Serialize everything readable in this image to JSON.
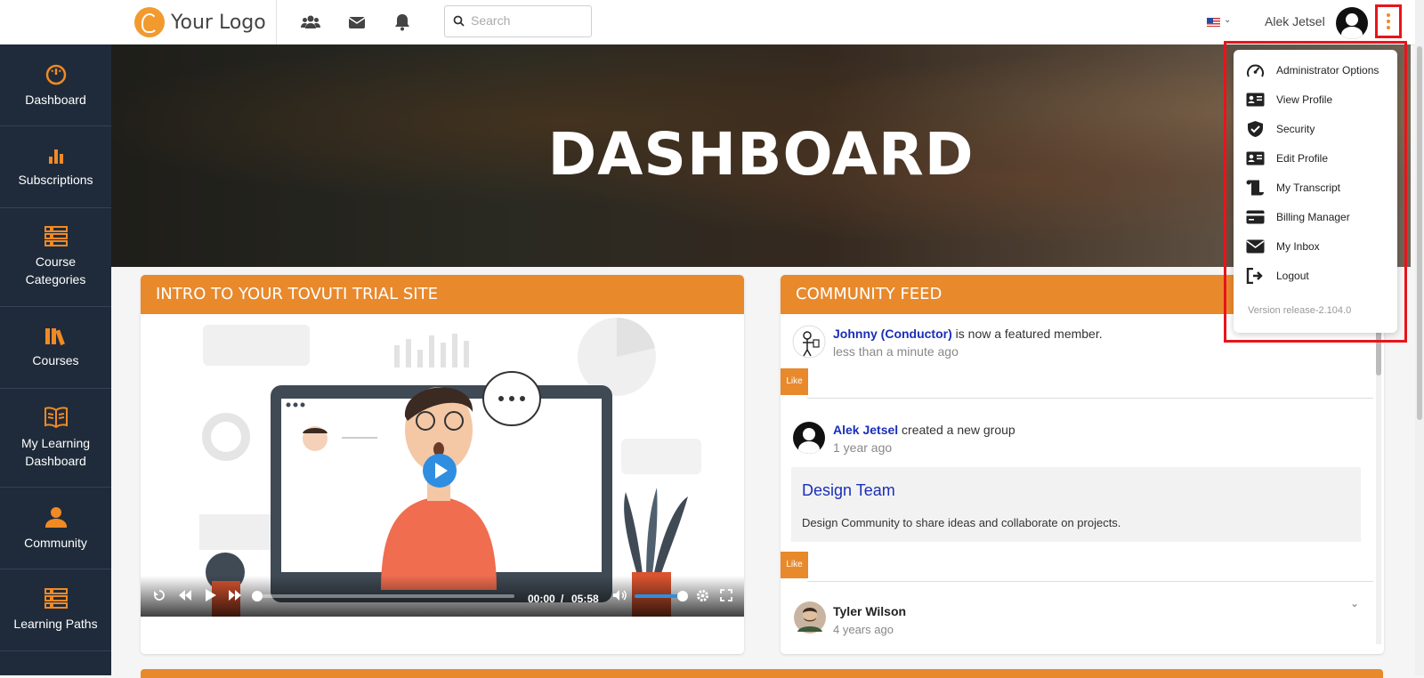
{
  "app": {
    "logo_text": "Your Logo",
    "username": "Alek Jetsel",
    "language_flag": "us-flag-icon"
  },
  "search": {
    "placeholder": "Search",
    "value": ""
  },
  "top_icons": [
    "users-icon",
    "envelope-icon",
    "bell-icon"
  ],
  "sidebar": {
    "items": [
      {
        "label": "Dashboard",
        "icon": "gauge-icon"
      },
      {
        "label": "Subscriptions",
        "icon": "bar-chart-icon"
      },
      {
        "label": "Course Categories",
        "icon": "list-icon"
      },
      {
        "label": "Courses",
        "icon": "books-icon"
      },
      {
        "label": "My Learning Dashboard",
        "icon": "open-book-icon"
      },
      {
        "label": "Community",
        "icon": "community-icon"
      },
      {
        "label": "Learning Paths",
        "icon": "list-icon"
      }
    ]
  },
  "banner": {
    "title": "DASHBOARD"
  },
  "intro_card": {
    "title": "INTRO TO YOUR TOVUTI TRIAL SITE",
    "video": {
      "current_time": "00:00",
      "separator": "/",
      "duration": "05:58",
      "progress": 0.0,
      "volume": 1.0
    }
  },
  "feed": {
    "title": "COMMUNITY FEED",
    "like_label": "Like",
    "items": [
      {
        "name": "Johnny (Conductor)",
        "action": " is now a featured member.",
        "time": "less than a minute ago"
      },
      {
        "name": "Alek Jetsel",
        "action": " created a new group",
        "time": "1 year ago",
        "group": {
          "title": "Design Team",
          "description": "Design Community to share ideas and collaborate on projects."
        }
      },
      {
        "name": "Tyler Wilson",
        "action": "",
        "time": "4 years ago"
      }
    ]
  },
  "dropdown": {
    "items": [
      {
        "label": "Administrator Options",
        "icon": "speedometer-icon"
      },
      {
        "label": "View Profile",
        "icon": "id-card-icon"
      },
      {
        "label": "Security",
        "icon": "shield-check-icon"
      },
      {
        "label": "Edit Profile",
        "icon": "id-card-icon"
      },
      {
        "label": "My Transcript",
        "icon": "scroll-icon"
      },
      {
        "label": "Billing Manager",
        "icon": "credit-card-icon"
      },
      {
        "label": "My Inbox",
        "icon": "envelope-icon"
      },
      {
        "label": "Logout",
        "icon": "logout-icon"
      }
    ],
    "version": "Version release-2.104.0"
  },
  "colors": {
    "accent": "#e8892c",
    "sidebar": "#1f2b3a",
    "link": "#1a2fb8",
    "highlight": "#e8141b"
  }
}
